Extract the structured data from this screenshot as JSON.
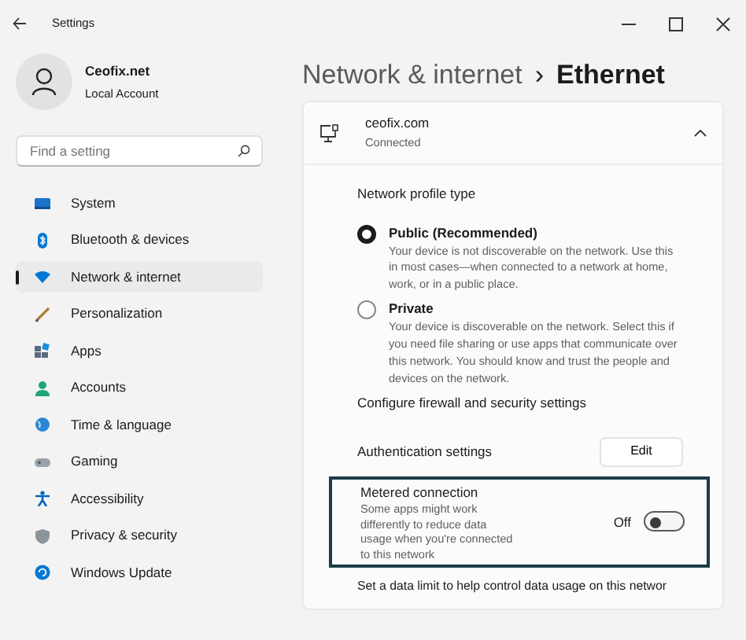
{
  "window": {
    "title": "Settings"
  },
  "account": {
    "name": "Ceofix.net",
    "type": "Local Account"
  },
  "search": {
    "placeholder": "Find a setting"
  },
  "nav": [
    {
      "label": "System",
      "kind": "system",
      "selected": false
    },
    {
      "label": "Bluetooth & devices",
      "kind": "bluetooth",
      "selected": false
    },
    {
      "label": "Network & internet",
      "kind": "network",
      "selected": true
    },
    {
      "label": "Personalization",
      "kind": "brush",
      "selected": false
    },
    {
      "label": "Apps",
      "kind": "apps",
      "selected": false
    },
    {
      "label": "Accounts",
      "kind": "person",
      "selected": false
    },
    {
      "label": "Time & language",
      "kind": "globe",
      "selected": false
    },
    {
      "label": "Gaming",
      "kind": "gamepad",
      "selected": false
    },
    {
      "label": "Accessibility",
      "kind": "accessibility",
      "selected": false
    },
    {
      "label": "Privacy & security",
      "kind": "shield",
      "selected": false
    },
    {
      "label": "Windows Update",
      "kind": "update",
      "selected": false
    }
  ],
  "breadcrumb": {
    "parent": "Network & internet",
    "separator": "›",
    "current": "Ethernet"
  },
  "network": {
    "name": "ceofix.com",
    "status": "Connected",
    "expanded": true
  },
  "profile": {
    "heading": "Network profile type",
    "options": [
      {
        "label": "Public (Recommended)",
        "description": "Your device is not discoverable on the network. Use this in most cases—when connected to a network at home, work, or in a public place.",
        "selected": true
      },
      {
        "label": "Private",
        "description": "Your device is discoverable on the network. Select this if you need file sharing or use apps that communicate over this network. You should know and trust the people and devices on the network.",
        "selected": false
      }
    ]
  },
  "firewall_link": "Configure firewall and security settings",
  "authentication": {
    "label": "Authentication settings",
    "button": "Edit"
  },
  "metered": {
    "title": "Metered connection",
    "description": "Some apps might work differently to reduce data usage when you're connected to this network",
    "state_label": "Off",
    "on": false,
    "highlighted": true
  },
  "data_limit": "Set a data limit to help control data usage on this networ"
}
